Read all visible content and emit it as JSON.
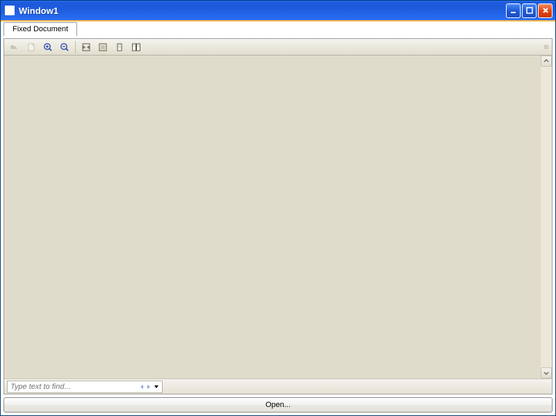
{
  "window": {
    "title": "Window1"
  },
  "tabs": [
    {
      "label": "Fixed Document",
      "active": true
    }
  ],
  "toolbar": {
    "items": [
      {
        "name": "copy-icon",
        "disabled": true
      },
      {
        "name": "print-icon",
        "disabled": true
      },
      {
        "name": "zoom-in-icon",
        "disabled": false
      },
      {
        "name": "zoom-out-icon",
        "disabled": false
      },
      {
        "sep": true
      },
      {
        "name": "fit-width-icon",
        "disabled": false
      },
      {
        "name": "whole-page-icon",
        "disabled": false
      },
      {
        "name": "single-page-icon",
        "disabled": false
      },
      {
        "name": "two-page-icon",
        "disabled": false
      }
    ]
  },
  "search": {
    "placeholder": "Type text to find..."
  },
  "buttons": {
    "open_label": "Open..."
  }
}
